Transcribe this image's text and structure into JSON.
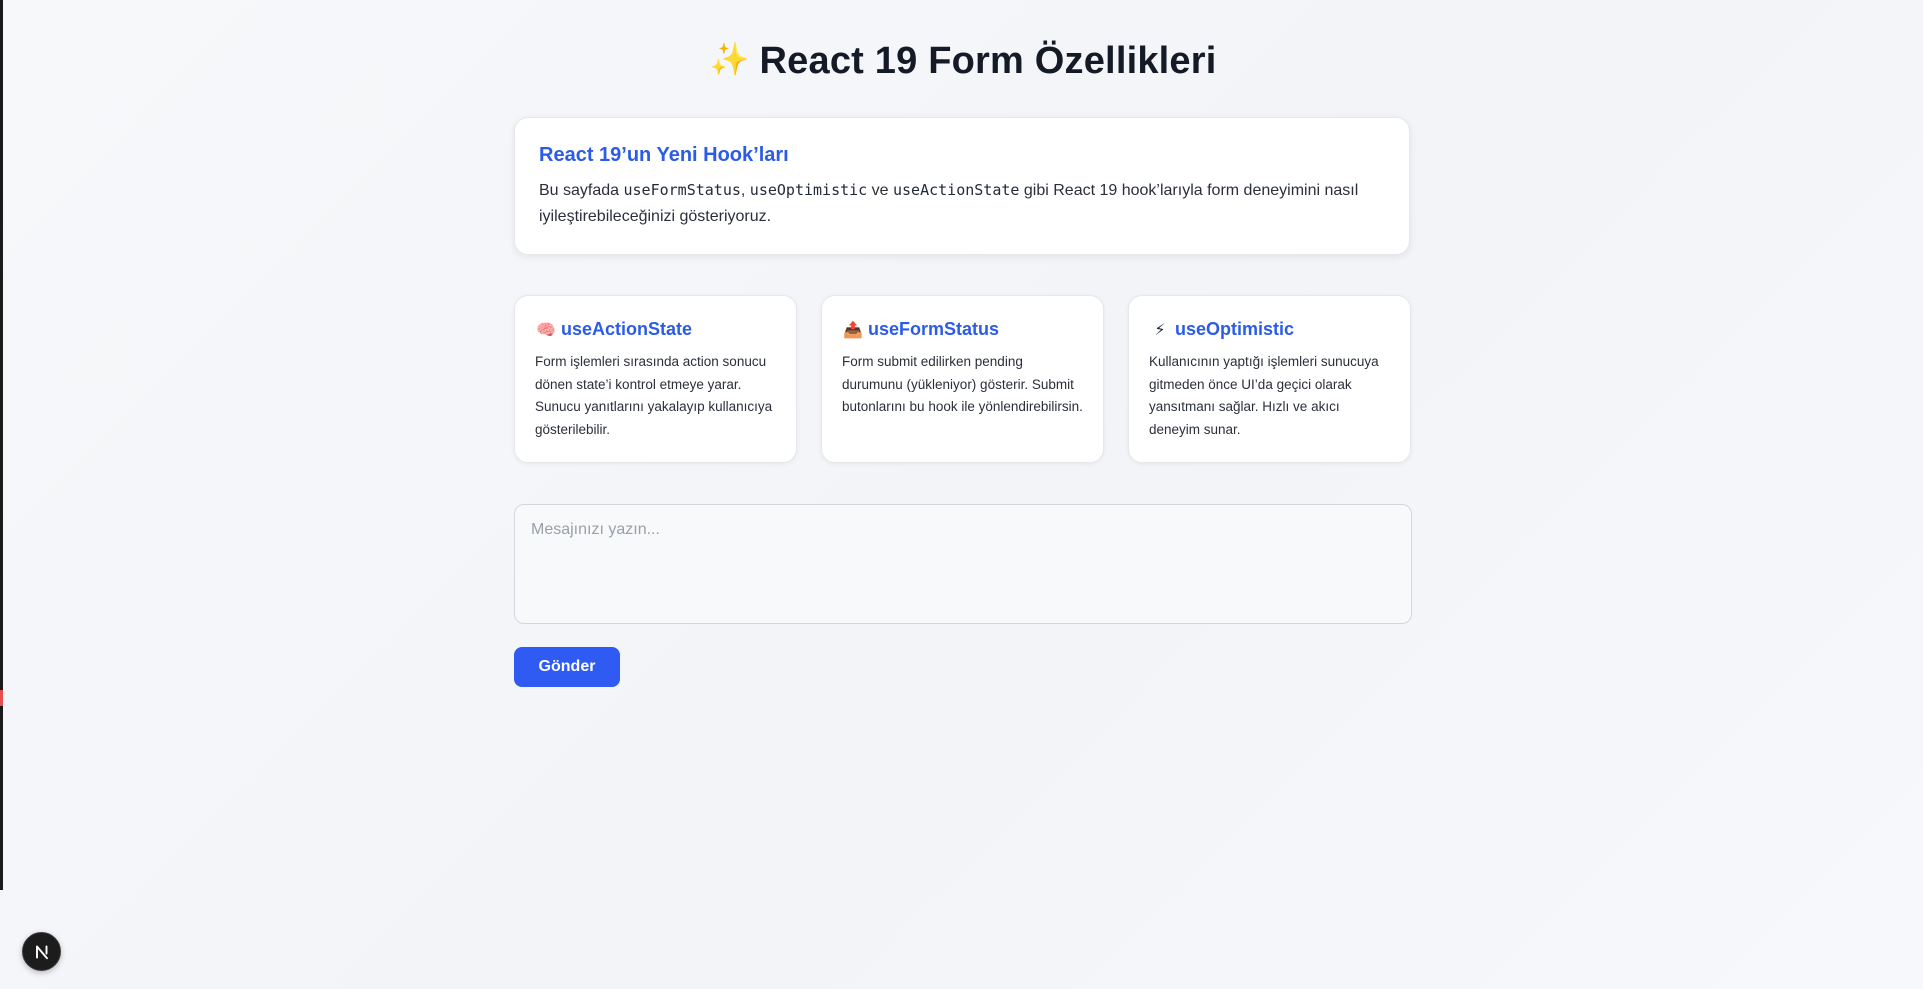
{
  "page": {
    "title_icon": "sparkles-icon",
    "title_emoji": "✨",
    "title": "React 19 Form Özellikleri"
  },
  "intro": {
    "title": "React 19’un Yeni Hook’ları",
    "text_before": "Bu sayfada ",
    "code1": "useFormStatus",
    "sep1": ", ",
    "code2": "useOptimistic",
    "sep2": " ve ",
    "code3": "useActionState",
    "text_after": " gibi React 19 hook’larıyla form deneyimini nasıl iyileştirebileceğinizi gösteriyoruz."
  },
  "features": [
    {
      "icon": "brain-icon",
      "emoji": "🧠",
      "title": "useActionState",
      "description": "Form işlemleri sırasında action sonucu dönen state’i kontrol etmeye yarar. Sunucu yanıtlarını yakalayıp kullanıcıya gösterilebilir."
    },
    {
      "icon": "outbox-tray-icon",
      "emoji": "📤",
      "title": "useFormStatus",
      "description": "Form submit edilirken pending durumunu (yükleniyor) gösterir. Submit butonlarını bu hook ile yönlendirebilirsin."
    },
    {
      "icon": "lightning-icon",
      "emoji": "⚡",
      "title": "useOptimistic",
      "description": "Kullanıcının yaptığı işlemleri sunucuya gitmeden önce UI’da geçici olarak yansıtmanı sağlar. Hızlı ve akıcı deneyim sunar."
    }
  ],
  "form": {
    "message_placeholder": "Mesajınızı yazın...",
    "message_value": "",
    "submit_label": "Gönder"
  },
  "dev_badge": {
    "icon": "nextjs-logo-icon",
    "letter": "N"
  },
  "colors": {
    "accent": "#2b5ce6",
    "button": "#2f5bf2",
    "title": "#141a26"
  }
}
